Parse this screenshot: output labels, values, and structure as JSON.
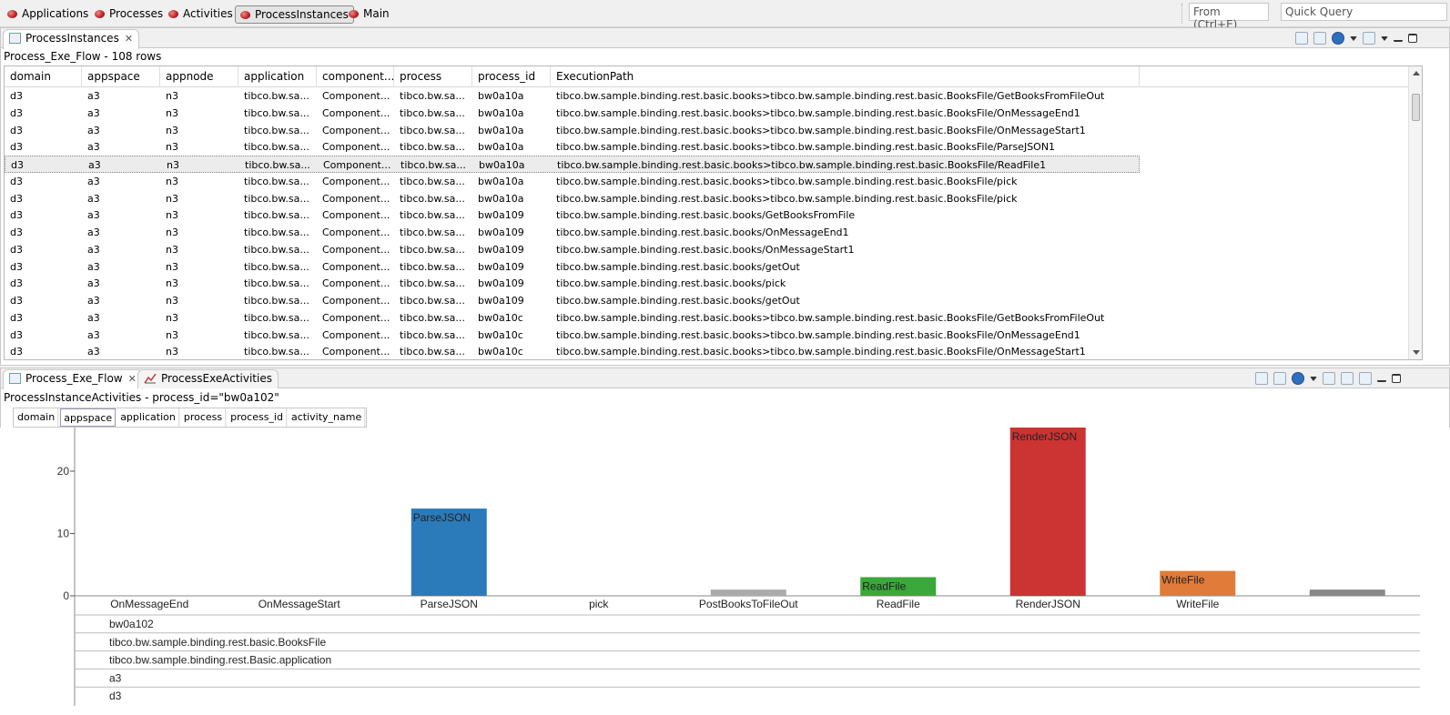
{
  "perspectives": [
    {
      "label": "Applications",
      "active": false
    },
    {
      "label": "Processes",
      "active": false
    },
    {
      "label": "Activities",
      "active": false
    },
    {
      "label": "ProcessInstances",
      "active": true
    },
    {
      "label": "Main",
      "active": false
    }
  ],
  "search": {
    "from_placeholder": "From (Ctrl+E)",
    "quick_query": "Quick Query"
  },
  "top_pane": {
    "tab_label": "ProcessInstances",
    "subtitle": "Process_Exe_Flow - 108 rows",
    "columns": [
      "domain",
      "appspace",
      "appnode",
      "application",
      "component...",
      "process",
      "process_id",
      "ExecutionPath"
    ],
    "rows": [
      [
        "d3",
        "a3",
        "n3",
        "tibco.bw.sa...",
        "Component...",
        "tibco.bw.sa...",
        "bw0a10a",
        "tibco.bw.sample.binding.rest.basic.books>tibco.bw.sample.binding.rest.basic.BooksFile/GetBooksFromFileOut"
      ],
      [
        "d3",
        "a3",
        "n3",
        "tibco.bw.sa...",
        "Component...",
        "tibco.bw.sa...",
        "bw0a10a",
        "tibco.bw.sample.binding.rest.basic.books>tibco.bw.sample.binding.rest.basic.BooksFile/OnMessageEnd1"
      ],
      [
        "d3",
        "a3",
        "n3",
        "tibco.bw.sa...",
        "Component...",
        "tibco.bw.sa...",
        "bw0a10a",
        "tibco.bw.sample.binding.rest.basic.books>tibco.bw.sample.binding.rest.basic.BooksFile/OnMessageStart1"
      ],
      [
        "d3",
        "a3",
        "n3",
        "tibco.bw.sa...",
        "Component...",
        "tibco.bw.sa...",
        "bw0a10a",
        "tibco.bw.sample.binding.rest.basic.books>tibco.bw.sample.binding.rest.basic.BooksFile/ParseJSON1"
      ],
      [
        "d3",
        "a3",
        "n3",
        "tibco.bw.sa...",
        "Component...",
        "tibco.bw.sa...",
        "bw0a10a",
        "tibco.bw.sample.binding.rest.basic.books>tibco.bw.sample.binding.rest.basic.BooksFile/ReadFile1"
      ],
      [
        "d3",
        "a3",
        "n3",
        "tibco.bw.sa...",
        "Component...",
        "tibco.bw.sa...",
        "bw0a10a",
        "tibco.bw.sample.binding.rest.basic.books>tibco.bw.sample.binding.rest.basic.BooksFile/pick"
      ],
      [
        "d3",
        "a3",
        "n3",
        "tibco.bw.sa...",
        "Component...",
        "tibco.bw.sa...",
        "bw0a10a",
        "tibco.bw.sample.binding.rest.basic.books>tibco.bw.sample.binding.rest.basic.BooksFile/pick"
      ],
      [
        "d3",
        "a3",
        "n3",
        "tibco.bw.sa...",
        "Component...",
        "tibco.bw.sa...",
        "bw0a109",
        "tibco.bw.sample.binding.rest.basic.books/GetBooksFromFile"
      ],
      [
        "d3",
        "a3",
        "n3",
        "tibco.bw.sa...",
        "Component...",
        "tibco.bw.sa...",
        "bw0a109",
        "tibco.bw.sample.binding.rest.basic.books/OnMessageEnd1"
      ],
      [
        "d3",
        "a3",
        "n3",
        "tibco.bw.sa...",
        "Component...",
        "tibco.bw.sa...",
        "bw0a109",
        "tibco.bw.sample.binding.rest.basic.books/OnMessageStart1"
      ],
      [
        "d3",
        "a3",
        "n3",
        "tibco.bw.sa...",
        "Component...",
        "tibco.bw.sa...",
        "bw0a109",
        "tibco.bw.sample.binding.rest.basic.books/getOut"
      ],
      [
        "d3",
        "a3",
        "n3",
        "tibco.bw.sa...",
        "Component...",
        "tibco.bw.sa...",
        "bw0a109",
        "tibco.bw.sample.binding.rest.basic.books/pick"
      ],
      [
        "d3",
        "a3",
        "n3",
        "tibco.bw.sa...",
        "Component...",
        "tibco.bw.sa...",
        "bw0a109",
        "tibco.bw.sample.binding.rest.basic.books/getOut"
      ],
      [
        "d3",
        "a3",
        "n3",
        "tibco.bw.sa...",
        "Component...",
        "tibco.bw.sa...",
        "bw0a10c",
        "tibco.bw.sample.binding.rest.basic.books>tibco.bw.sample.binding.rest.basic.BooksFile/GetBooksFromFileOut"
      ],
      [
        "d3",
        "a3",
        "n3",
        "tibco.bw.sa...",
        "Component...",
        "tibco.bw.sa...",
        "bw0a10c",
        "tibco.bw.sample.binding.rest.basic.books>tibco.bw.sample.binding.rest.basic.BooksFile/OnMessageEnd1"
      ],
      [
        "d3",
        "a3",
        "n3",
        "tibco.bw.sa...",
        "Component...",
        "tibco.bw.sa...",
        "bw0a10c",
        "tibco.bw.sample.binding.rest.basic.books>tibco.bw.sample.binding.rest.basic.BooksFile/OnMessageStart1"
      ]
    ],
    "selected_row": 4
  },
  "bottom_pane": {
    "tabs": [
      {
        "label": "Process_Exe_Flow",
        "active": true
      },
      {
        "label": "ProcessExeActivities",
        "active": false
      }
    ],
    "subtitle": "ProcessInstanceActivities - process_id=\"bw0a102\"",
    "chips": [
      "domain",
      "appspace",
      "application",
      "process",
      "process_id",
      "activity_name"
    ]
  },
  "chart_data": {
    "type": "bar",
    "categories": [
      "OnMessageEnd",
      "OnMessageStart",
      "ParseJSON",
      "pick",
      "PostBooksToFileOut",
      "ReadFile",
      "RenderJSON",
      "WriteFile",
      ""
    ],
    "values": [
      0,
      0,
      14,
      0,
      1,
      3,
      27,
      4,
      1
    ],
    "bar_labels": [
      "",
      "",
      "ParseJSON",
      "",
      "",
      "ReadFile",
      "RenderJSON",
      "WriteFile",
      ""
    ],
    "colors": [
      "#2b7bba",
      "#2b7bba",
      "#2b7bba",
      "#2b7bba",
      "#aaaaaa",
      "#3aa83a",
      "#cc3333",
      "#e07b39",
      "#888888"
    ],
    "yticks": [
      0,
      10,
      20
    ],
    "ylim": [
      0,
      27
    ],
    "group_rows": [
      "bw0a102",
      "tibco.bw.sample.binding.rest.basic.BooksFile",
      "tibco.bw.sample.binding.rest.Basic.application",
      "a3",
      "d3"
    ]
  }
}
